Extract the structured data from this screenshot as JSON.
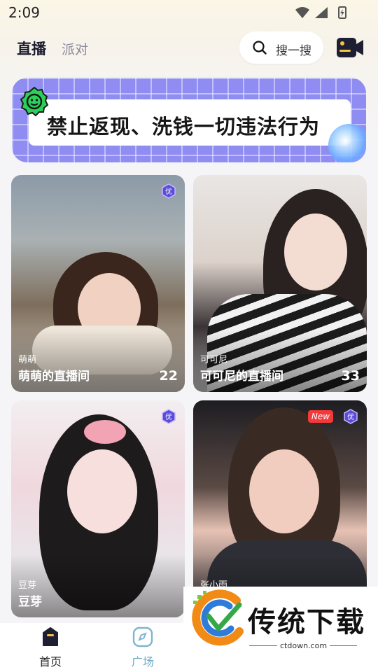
{
  "status_bar": {
    "time": "2:09"
  },
  "header": {
    "tabs": [
      {
        "label": "直播",
        "active": true
      },
      {
        "label": "派对",
        "active": false
      }
    ],
    "search": {
      "placeholder": "搜一搜"
    }
  },
  "banner": {
    "text": "禁止返现、洗钱一切违法行为"
  },
  "rooms": [
    {
      "host": "萌萌",
      "title": "萌萌的直播间",
      "count": "22",
      "badges": [
        "优"
      ]
    },
    {
      "host": "可可尼",
      "title": "可可尼的直播间",
      "count": "33",
      "badges": []
    },
    {
      "host": "豆芽",
      "title": "豆芽",
      "count": "",
      "badges": [
        "优"
      ]
    },
    {
      "host": "张小雨",
      "title": "",
      "count": "",
      "badges": [
        "New",
        "优"
      ]
    }
  ],
  "bottom_nav": [
    {
      "label": "首页",
      "active": true
    },
    {
      "label": "广场",
      "active": false
    }
  ],
  "watermark": {
    "title": "传统下载",
    "domain": "ctdown.com"
  },
  "colors": {
    "brand_dark": "#1a1a2e",
    "inactive_tab": "#8a8a9a",
    "banner_purple": "#8f8df2",
    "new_badge": "#f23a3a",
    "plaza_blue": "#6ca9c6"
  }
}
